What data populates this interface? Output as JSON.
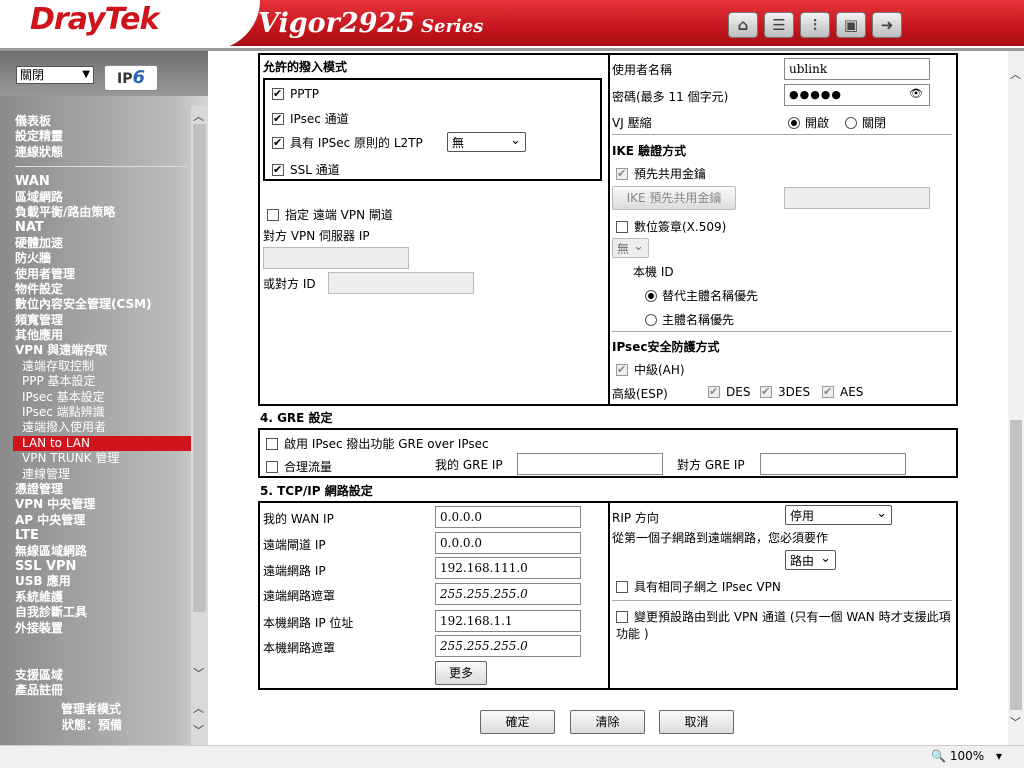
{
  "header": {
    "brand": "DrayTek",
    "model": "Vigor2925",
    "series": "Series"
  },
  "sidebar": {
    "language": "關閉",
    "ipv6": "IPv6",
    "items": [
      {
        "label": "儀表板",
        "style": "main"
      },
      {
        "label": "設定精靈",
        "style": "main"
      },
      {
        "label": "連線狀態",
        "style": "main"
      },
      {
        "label": "WAN",
        "style": "big"
      },
      {
        "label": "區域網路",
        "style": "main"
      },
      {
        "label": "負載平衡/路由策略",
        "style": "main"
      },
      {
        "label": "NAT",
        "style": "big"
      },
      {
        "label": "硬體加速",
        "style": "main"
      },
      {
        "label": "防火牆",
        "style": "main"
      },
      {
        "label": "使用者管理",
        "style": "main"
      },
      {
        "label": "物件設定",
        "style": "main"
      },
      {
        "label": "數位內容安全管理(CSM)",
        "style": "main"
      },
      {
        "label": "頻寬管理",
        "style": "main"
      },
      {
        "label": "其他應用",
        "style": "main"
      },
      {
        "label": "VPN 與遠端存取",
        "style": "main"
      },
      {
        "label": "遠端存取控制",
        "style": "sub"
      },
      {
        "label": "PPP 基本設定",
        "style": "sub"
      },
      {
        "label": "IPsec 基本設定",
        "style": "sub"
      },
      {
        "label": "IPsec 端點辨識",
        "style": "sub"
      },
      {
        "label": "遠端撥入使用者",
        "style": "sub"
      },
      {
        "label": "LAN to LAN",
        "style": "active"
      },
      {
        "label": "VPN TRUNK 管理",
        "style": "sub"
      },
      {
        "label": "連線管理",
        "style": "sub"
      },
      {
        "label": "憑證管理",
        "style": "main"
      },
      {
        "label": "VPN 中央管理",
        "style": "main"
      },
      {
        "label": "AP 中央管理",
        "style": "main"
      },
      {
        "label": "LTE",
        "style": "big"
      },
      {
        "label": "無線區域網路",
        "style": "main"
      },
      {
        "label": "SSL VPN",
        "style": "big"
      },
      {
        "label": "USB 應用",
        "style": "main"
      },
      {
        "label": "系統維護",
        "style": "main"
      },
      {
        "label": "自我診斷工具",
        "style": "main"
      },
      {
        "label": "外接裝置",
        "style": "main"
      }
    ],
    "bottom_items": [
      "支援區域",
      "產品註冊"
    ],
    "admin_mode": "管理者模式",
    "status": "狀態：預備"
  },
  "dialin": {
    "title": "允許的撥入模式",
    "pptp": "PPTP",
    "ipsec": "IPsec 通道",
    "l2tp": "具有 IPSec 原則的 L2TP",
    "l2tp_select": "無",
    "ssl": "SSL 通道",
    "specify_gw": "指定 遠端 VPN 閘道",
    "peer_server_ip": "對方 VPN 伺服器 IP",
    "peer_id": "或對方 ID"
  },
  "auth": {
    "username_label": "使用者名稱",
    "username": "ublink",
    "password_label": "密碼(最多 11 個字元)",
    "password": "●●●●●",
    "vj_label": "VJ 壓縮",
    "vj_on": "開啟",
    "vj_off": "關閉",
    "ike_title": "IKE 驗證方式",
    "psk": "預先共用金鑰",
    "psk_button": "IKE 預先共用金鑰",
    "cert": "數位簽章(X.509)",
    "cert_select": "無",
    "local_id": "本機 ID",
    "alt_subject": "替代主體名稱優先",
    "subject": "主體名稱優先",
    "ipsec_title": "IPsec安全防護方式",
    "ah": "中級(AH)",
    "esp": "高級(ESP)",
    "des": "DES",
    "3des": "3DES",
    "aes": "AES"
  },
  "gre": {
    "title": "4. GRE 設定",
    "enable": "啟用 IPsec 撥出功能 GRE over IPsec",
    "logical": "合理流量",
    "my_ip": "我的 GRE IP",
    "peer_ip": "對方 GRE IP"
  },
  "tcpip": {
    "title": "5. TCP/IP 網路設定",
    "my_wan_ip_label": "我的 WAN IP",
    "my_wan_ip": "0.0.0.0",
    "remote_gw_label": "遠端閘道 IP",
    "remote_gw": "0.0.0.0",
    "remote_net_label": "遠端網路 IP",
    "remote_net": "192.168.111.0",
    "remote_mask_label": "遠端網路遮罩",
    "remote_mask": "255.255.255.0",
    "local_ip_label": "本機網路 IP 位址",
    "local_ip": "192.168.1.1",
    "local_mask_label": "本機網路遮罩",
    "local_mask": "255.255.255.0",
    "more": "更多",
    "rip_label": "RIP 方向",
    "rip_value": "停用",
    "from_first": "從第一個子網路到遠端網路，您必須要作",
    "route_value": "路由",
    "same_subnet": "具有相同子網之 IPsec VPN",
    "change_default": "變更預設路由到此 VPN 通道 (只有一個 WAN 時才支援此項功能 )"
  },
  "actions": {
    "ok": "確定",
    "clear": "清除",
    "cancel": "取消"
  },
  "statusbar": {
    "zoom": "100%"
  }
}
